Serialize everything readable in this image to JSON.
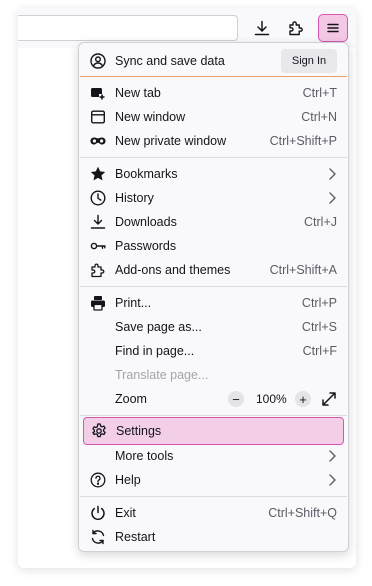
{
  "toolbar": {
    "download_icon": "download-icon",
    "extensions_icon": "puzzle-icon",
    "menu_icon": "hamburger-icon"
  },
  "menu": {
    "sync": {
      "label": "Sync and save data",
      "button": "Sign In"
    },
    "group1": [
      {
        "label": "New tab",
        "shortcut": "Ctrl+T",
        "icon": "new-tab-icon"
      },
      {
        "label": "New window",
        "shortcut": "Ctrl+N",
        "icon": "window-icon"
      },
      {
        "label": "New private window",
        "shortcut": "Ctrl+Shift+P",
        "icon": "private-mask-icon"
      }
    ],
    "group2": [
      {
        "label": "Bookmarks",
        "icon": "star-icon",
        "submenu": true
      },
      {
        "label": "History",
        "icon": "clock-icon",
        "submenu": true
      },
      {
        "label": "Downloads",
        "shortcut": "Ctrl+J",
        "icon": "download-icon"
      },
      {
        "label": "Passwords",
        "icon": "key-icon"
      },
      {
        "label": "Add-ons and themes",
        "shortcut": "Ctrl+Shift+A",
        "icon": "puzzle-icon"
      }
    ],
    "group3": [
      {
        "label": "Print...",
        "shortcut": "Ctrl+P",
        "icon": "printer-icon"
      },
      {
        "label": "Save page as...",
        "shortcut": "Ctrl+S"
      },
      {
        "label": "Find in page...",
        "shortcut": "Ctrl+F"
      },
      {
        "label": "Translate page...",
        "disabled": true
      },
      {
        "label": "Zoom",
        "zoom_level": "100%"
      }
    ],
    "group4": [
      {
        "label": "Settings",
        "icon": "gear-icon",
        "selected": true
      },
      {
        "label": "More tools",
        "submenu": true
      },
      {
        "label": "Help",
        "icon": "help-icon",
        "submenu": true
      }
    ],
    "group5": [
      {
        "label": "Exit",
        "shortcut": "Ctrl+Shift+Q",
        "icon": "power-icon"
      },
      {
        "label": "Restart",
        "icon": "restart-icon"
      }
    ]
  },
  "colors": {
    "accent_pink": "#d657b2",
    "selected_bg": "#f2cfe6",
    "sync_underline": "#e8a070"
  }
}
